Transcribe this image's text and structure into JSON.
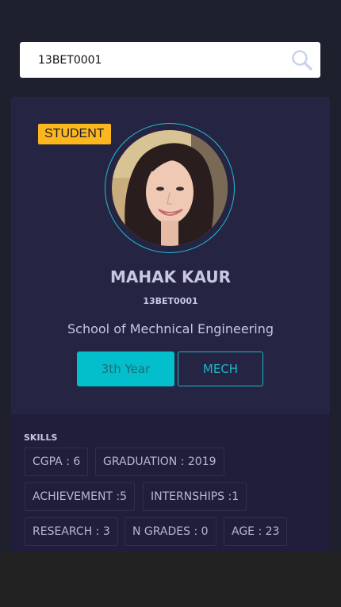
{
  "search": {
    "value": "13BET0001",
    "icon": "search-icon"
  },
  "profile": {
    "badge": "STUDENT",
    "name": "MAHAK KAUR",
    "id": "13BET0001",
    "school": "School of Mechnical Engineering",
    "year_label": "3th Year",
    "dept_label": "MECH"
  },
  "skills": {
    "heading": "SKILLS",
    "items": [
      "CGPA : 6",
      "GRADUATION : 2019",
      "ACHIEVEMENT :5",
      "INTERNSHIPS :1",
      "RESEARCH : 3",
      "N GRADES : 0",
      "AGE : 23"
    ]
  },
  "colors": {
    "accent": "#03bfcb",
    "badge": "#fbb71d",
    "card": "#262443",
    "background": "#1e202e"
  }
}
